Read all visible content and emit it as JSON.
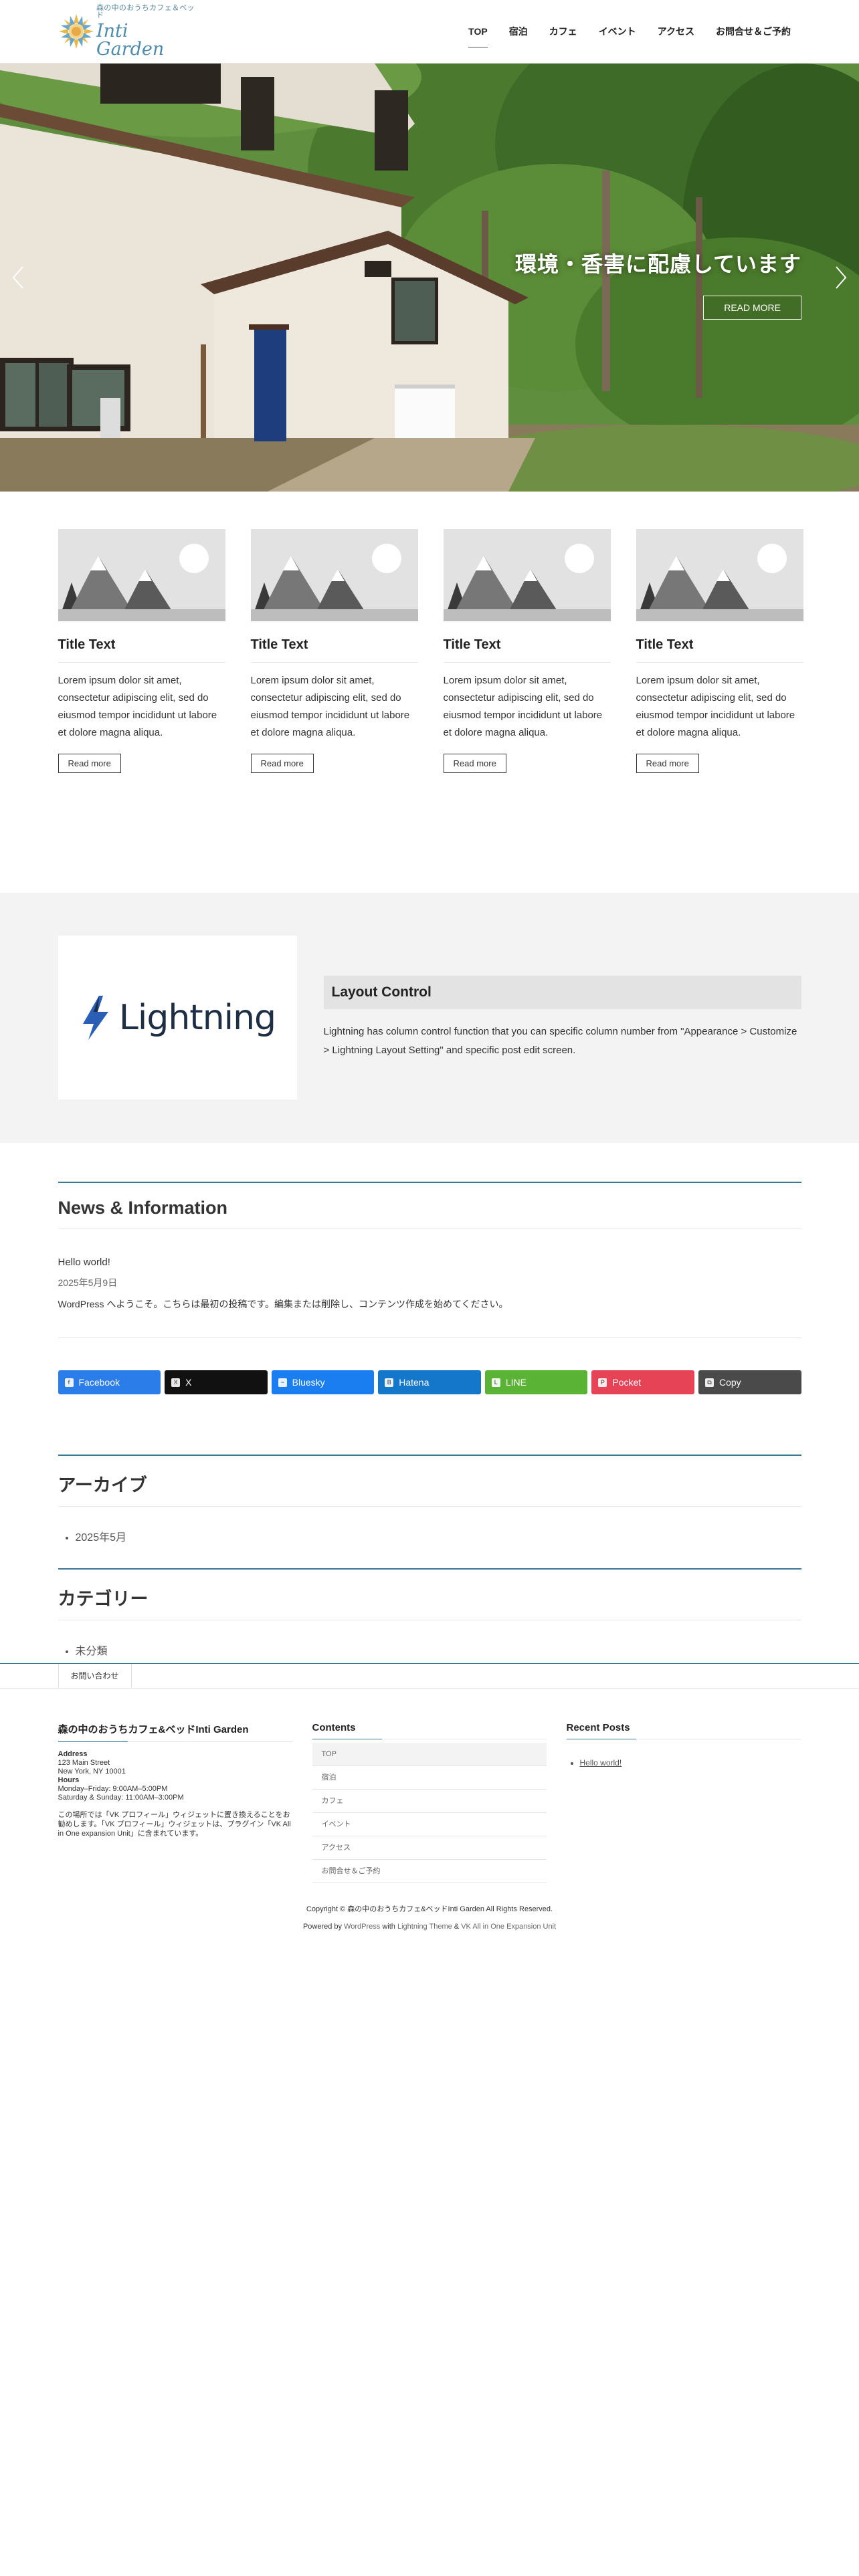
{
  "header": {
    "logo_sub": "森の中のおうちカフェ＆ベッド",
    "logo_main": "Inti Garden",
    "nav": [
      {
        "label": "TOP"
      },
      {
        "label": "宿泊"
      },
      {
        "label": "カフェ"
      },
      {
        "label": "イベント"
      },
      {
        "label": "アクセス"
      },
      {
        "label": "お問合せ＆ご予約"
      }
    ]
  },
  "slider": {
    "caption": "環境・香害に配慮しています",
    "button": "READ MORE"
  },
  "cards": [
    {
      "title": "Title Text",
      "body": "Lorem ipsum dolor sit amet, consectetur adipiscing elit, sed do eiusmod tempor incididunt ut labore et dolore magna aliqua.",
      "button": "Read more"
    },
    {
      "title": "Title Text",
      "body": "Lorem ipsum dolor sit amet, consectetur adipiscing elit, sed do eiusmod tempor incididunt ut labore et dolore magna aliqua.",
      "button": "Read more"
    },
    {
      "title": "Title Text",
      "body": "Lorem ipsum dolor sit amet, consectetur adipiscing elit, sed do eiusmod tempor incididunt ut labore et dolore magna aliqua.",
      "button": "Read more"
    },
    {
      "title": "Title Text",
      "body": "Lorem ipsum dolor sit amet, consectetur adipiscing elit, sed do eiusmod tempor incididunt ut labore et dolore magna aliqua.",
      "button": "Read more"
    }
  ],
  "band": {
    "logo_text": "Lightning",
    "title": "Layout Control",
    "body": "Lightning has column control function that you can specific column number from \"Appearance > Customize > Lightning Layout Setting\" and specific post edit screen."
  },
  "news": {
    "title": "News & Information",
    "post_title": "Hello world!",
    "post_date": "2025年5月9日",
    "post_excerpt": "WordPress へようこそ。こちらは最初の投稿です。編集または削除し、コンテンツ作成を始めてください。"
  },
  "share": [
    {
      "label": "Facebook",
      "color": "#2b7de9",
      "icon": "facebook-icon"
    },
    {
      "label": "X",
      "color": "#111111",
      "icon": "x-icon"
    },
    {
      "label": "Bluesky",
      "color": "#1a7ef0",
      "icon": "bluesky-icon"
    },
    {
      "label": "Hatena",
      "color": "#1577c9",
      "icon": "hatena-icon"
    },
    {
      "label": "LINE",
      "color": "#5bb336",
      "icon": "line-icon"
    },
    {
      "label": "Pocket",
      "color": "#e64356",
      "icon": "pocket-icon"
    },
    {
      "label": "Copy",
      "color": "#4a4a4a",
      "icon": "copy-icon"
    }
  ],
  "archive": {
    "title": "アーカイブ",
    "items": [
      "2025年5月"
    ]
  },
  "category": {
    "title": "カテゴリー",
    "items": [
      "未分類"
    ]
  },
  "subnav": {
    "link": "お問い合わせ"
  },
  "footer": {
    "about": {
      "title": "森の中のおうちカフェ&ベッドInti Garden",
      "address_label": "Address",
      "address_1": "123 Main Street",
      "address_2": "New York, NY 10001",
      "hours_label": "Hours",
      "hours_1": "Monday–Friday: 9:00AM–5:00PM",
      "hours_2": "Saturday & Sunday: 11:00AM–3:00PM",
      "note": "この場所では「VK プロフィール」ウィジェットに置き換えることをお勧めします。「VK プロフィール」ウィジェットは、プラグイン「VK All in One expansion Unit」に含まれています。"
    },
    "contents": {
      "title": "Contents",
      "items": [
        "TOP",
        "宿泊",
        "カフェ",
        "イベント",
        "アクセス",
        "お問合せ＆ご予約"
      ]
    },
    "recent": {
      "title": "Recent Posts",
      "items": [
        "Hello world!"
      ]
    },
    "copyright": "Copyright © 森の中のおうちカフェ&ベッドInti Garden All Rights Reserved.",
    "powered_prefix": "Powered by",
    "powered_wp": "WordPress",
    "powered_with": "with",
    "powered_theme": "Lightning Theme",
    "powered_amp": "&",
    "powered_vk": "VK All in One Expansion Unit"
  }
}
